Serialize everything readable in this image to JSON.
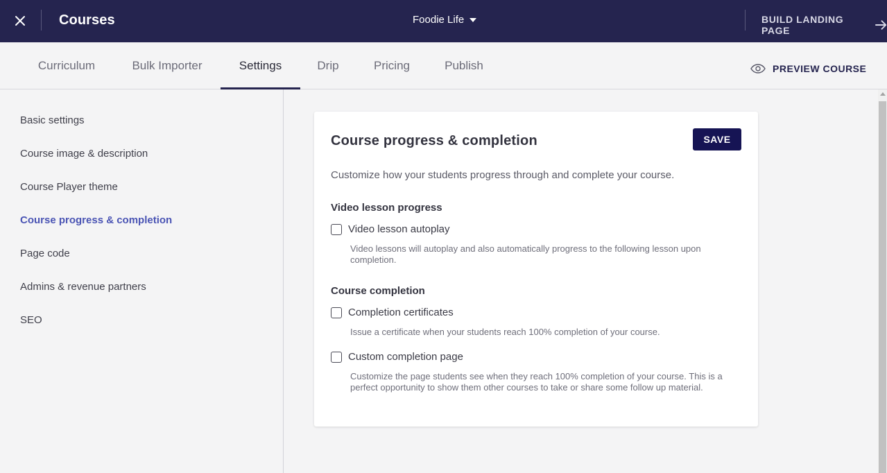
{
  "topbar": {
    "title": "Courses",
    "school_name": "Foodie Life",
    "build_landing_label": "BUILD LANDING PAGE"
  },
  "tabs": [
    {
      "label": "Curriculum"
    },
    {
      "label": "Bulk Importer"
    },
    {
      "label": "Settings",
      "active": true
    },
    {
      "label": "Drip"
    },
    {
      "label": "Pricing"
    },
    {
      "label": "Publish"
    }
  ],
  "preview_label": "PREVIEW COURSE",
  "sidebar": {
    "items": [
      {
        "label": "Basic settings"
      },
      {
        "label": "Course image & description"
      },
      {
        "label": "Course Player theme"
      },
      {
        "label": "Course progress & completion",
        "active": true
      },
      {
        "label": "Page code"
      },
      {
        "label": "Admins & revenue partners"
      },
      {
        "label": "SEO"
      }
    ]
  },
  "card": {
    "title": "Course progress & completion",
    "save_label": "SAVE",
    "description": "Customize how your students progress through and complete your course.",
    "sections": [
      {
        "title": "Video lesson progress",
        "options": [
          {
            "label": "Video lesson autoplay",
            "checked": false,
            "help": "Video lessons will autoplay and also automatically progress to the following lesson upon completion."
          }
        ]
      },
      {
        "title": "Course completion",
        "options": [
          {
            "label": "Completion certificates",
            "checked": false,
            "help": "Issue a certificate when your students reach 100% completion of your course."
          },
          {
            "label": "Custom completion page",
            "checked": false,
            "help": "Customize the page students see when they reach 100% completion of your course. This is a perfect opportunity to show them other courses to take or share some follow up material."
          }
        ]
      }
    ]
  },
  "colors": {
    "topbar_bg": "#25244f",
    "accent": "#4a54b4",
    "save_bg": "#161454"
  }
}
